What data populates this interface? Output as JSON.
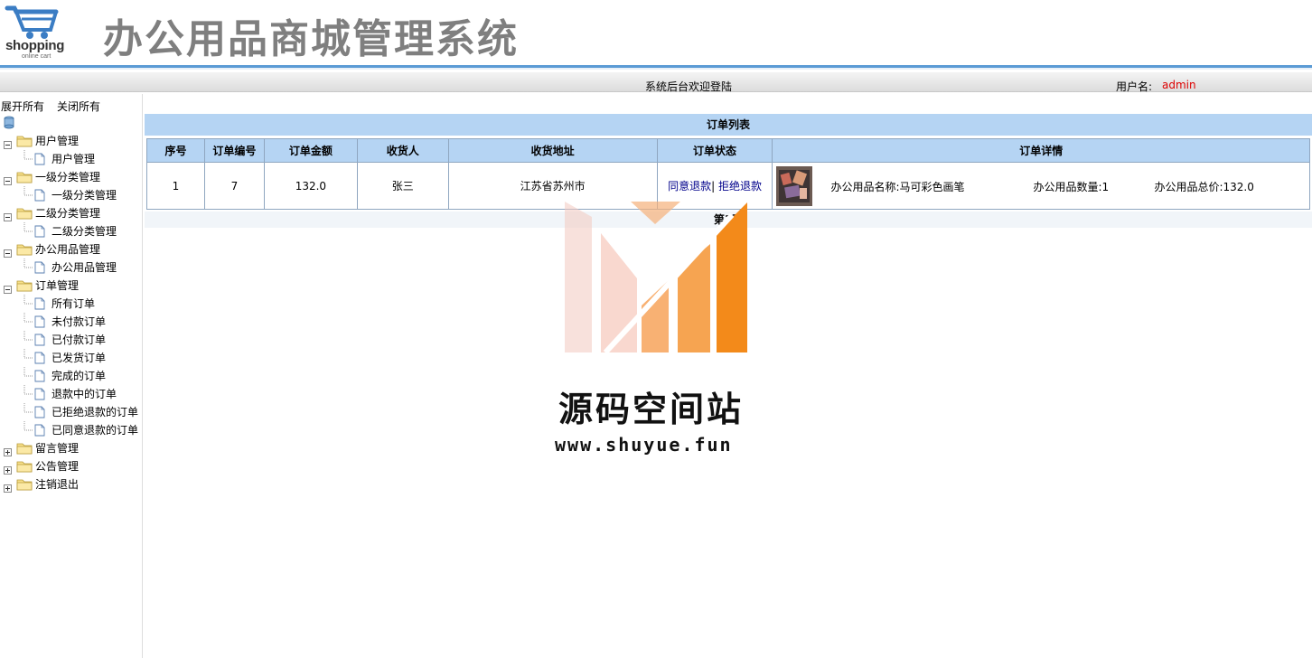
{
  "header": {
    "logo_word": "shopping",
    "logo_sub": "online cart",
    "title": "办公用品商城管理系统"
  },
  "status_bar": {
    "welcome": "系统后台欢迎登陆",
    "user_label": "用户名:",
    "user_name": "admin"
  },
  "sidebar": {
    "expand_all": "展开所有",
    "collapse_all": "关闭所有",
    "tree": [
      {
        "label": "用户管理",
        "type": "folder",
        "expanded": true
      },
      {
        "label": "用户管理",
        "type": "page"
      },
      {
        "label": "一级分类管理",
        "type": "folder",
        "expanded": true
      },
      {
        "label": "一级分类管理",
        "type": "page"
      },
      {
        "label": "二级分类管理",
        "type": "folder",
        "expanded": true
      },
      {
        "label": "二级分类管理",
        "type": "page"
      },
      {
        "label": "办公用品管理",
        "type": "folder",
        "expanded": true
      },
      {
        "label": "办公用品管理",
        "type": "page"
      },
      {
        "label": "订单管理",
        "type": "folder",
        "expanded": true
      },
      {
        "label": "所有订单",
        "type": "page"
      },
      {
        "label": "未付款订单",
        "type": "page"
      },
      {
        "label": "已付款订单",
        "type": "page"
      },
      {
        "label": "已发货订单",
        "type": "page"
      },
      {
        "label": "完成的订单",
        "type": "page"
      },
      {
        "label": "退款中的订单",
        "type": "page"
      },
      {
        "label": "已拒绝退款的订单",
        "type": "page"
      },
      {
        "label": "已同意退款的订单",
        "type": "page"
      },
      {
        "label": "留言管理",
        "type": "folder",
        "expanded": false
      },
      {
        "label": "公告管理",
        "type": "folder",
        "expanded": false
      },
      {
        "label": "注销退出",
        "type": "folder",
        "expanded": false
      }
    ]
  },
  "main": {
    "list_title": "订单列表",
    "columns": [
      "序号",
      "订单编号",
      "订单金额",
      "收货人",
      "收货地址",
      "订单状态",
      "订单详情"
    ],
    "rows": [
      {
        "index": "1",
        "order_no": "7",
        "amount": "132.0",
        "receiver": "张三",
        "address": "江苏省苏州市",
        "agree_link": "同意退款",
        "separator": "|",
        "reject_link": "拒绝退款",
        "product_name": "办公用品名称:马可彩色画笔",
        "product_qty": "办公用品数量:1",
        "product_total": "办公用品总价:132.0"
      }
    ],
    "pagination": "第1页"
  },
  "watermark": {
    "name": "源码空间站",
    "url": "www.shuyue.fun"
  },
  "colors": {
    "header_blue": "#5b9bd5",
    "table_header_bg": "#b5d4f3",
    "user_name": "#dd0000",
    "link": "#00008b",
    "title_gray": "#7f7f7f"
  }
}
